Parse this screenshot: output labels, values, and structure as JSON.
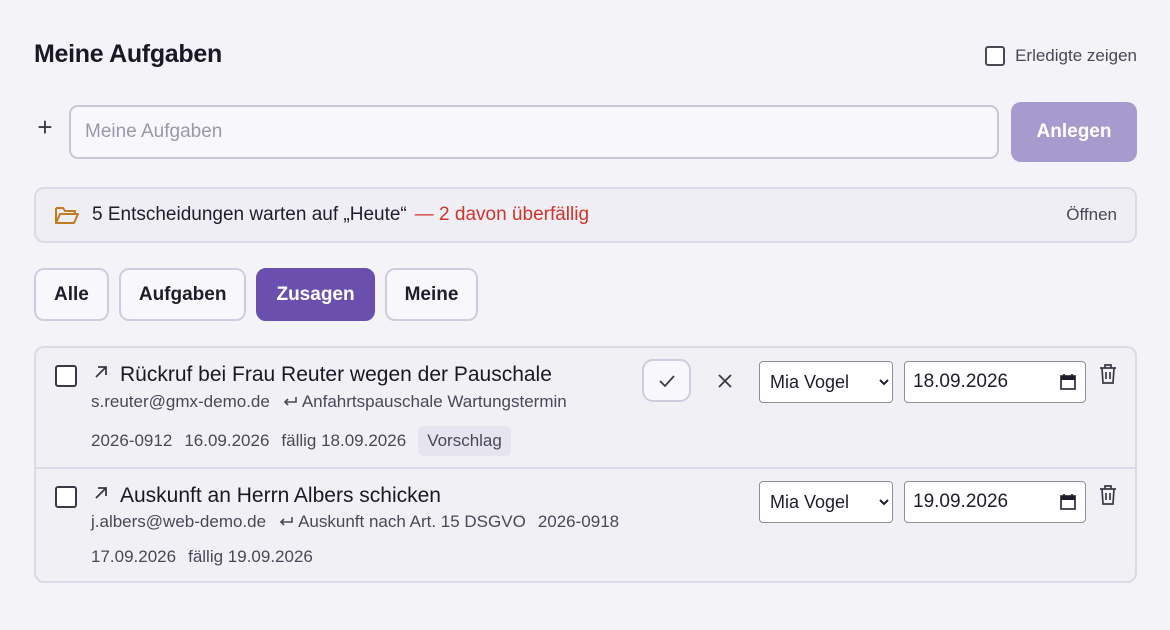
{
  "header": {
    "title": "Meine Aufgaben",
    "show_done_label": "Erledigte zeigen"
  },
  "add": {
    "placeholder": "Meine Aufgaben",
    "button_label": "Anlegen"
  },
  "banner": {
    "text": "5 Entscheidungen warten auf „Heute“",
    "overdue_text": "— 2 davon überfällig",
    "open_label": "Öffnen",
    "icon": "folder-open-icon",
    "overdue_color": "#d0342c"
  },
  "tabs": [
    {
      "label": "Alle",
      "active": false
    },
    {
      "label": "Aufgaben",
      "active": false
    },
    {
      "label": "Zusagen",
      "active": true
    },
    {
      "label": "Meine",
      "active": false
    }
  ],
  "accent_color": "#6a4fae",
  "items": [
    {
      "title": "Rückruf bei Frau Reuter wegen der Pauschale",
      "email": "s.reuter@gmx-demo.de",
      "reference": "Anfahrtspauschale Wartungstermin",
      "number": "2026-0912",
      "date": "16.09.2026",
      "due_text": "fällig 18.09.2026",
      "badge": "Vorschlag",
      "assignee": "Mia Vogel",
      "due_date": "18.09.2026"
    },
    {
      "title": "Auskunft an Herrn Albers schicken",
      "email": "j.albers@web-demo.de",
      "reference": "Auskunft nach Art. 15 DSGVO",
      "number": "2026-0918",
      "date": "17.09.2026",
      "due_text": "fällig 19.09.2026",
      "assignee": "Mia Vogel",
      "due_date": "19.09.2026"
    }
  ]
}
